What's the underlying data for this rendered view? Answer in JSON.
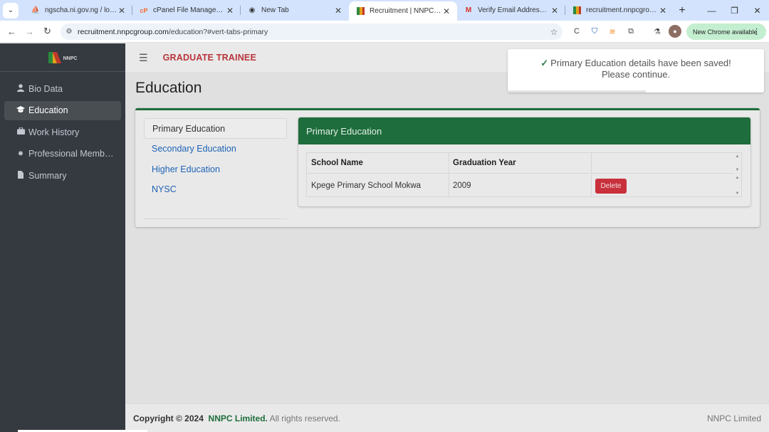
{
  "browser": {
    "tabs": [
      {
        "title": "ngscha.ni.gov.ng / localho",
        "favicon": "pma-icon",
        "active": false
      },
      {
        "title": "cPanel File Manager v3",
        "favicon": "cpanel-icon",
        "active": false
      },
      {
        "title": "New Tab",
        "favicon": "chrome-icon",
        "active": false
      },
      {
        "title": "Recruitment | NNPC Limite",
        "favicon": "nnpc-icon",
        "active": true
      },
      {
        "title": "Verify Email Address - abd",
        "favicon": "gmail-icon",
        "active": false
      },
      {
        "title": "recruitment.nnpcgroup.co",
        "favicon": "nnpc-icon",
        "active": false
      }
    ],
    "url_host": "recruitment.nnpcgroup.com",
    "url_path": "/education?#vert-tabs-primary",
    "new_chrome_label": "New Chrome available"
  },
  "sidebar": {
    "logo_text": "NNPC",
    "items": [
      {
        "label": "Bio Data",
        "icon": "user-icon",
        "active": false
      },
      {
        "label": "Education",
        "icon": "graduation-cap-icon",
        "active": true
      },
      {
        "label": "Work History",
        "icon": "briefcase-icon",
        "active": false
      },
      {
        "label": "Professional Memb…",
        "icon": "cog-icon",
        "active": false
      },
      {
        "label": "Summary",
        "icon": "file-icon",
        "active": false
      }
    ]
  },
  "topbar": {
    "title": "GRADUATE TRAINEE"
  },
  "page": {
    "title": "Education"
  },
  "education_tabs": [
    {
      "label": "Primary Education",
      "active": true
    },
    {
      "label": "Secondary Education",
      "active": false
    },
    {
      "label": "Higher Education",
      "active": false
    },
    {
      "label": "NYSC",
      "active": false
    }
  ],
  "panel": {
    "title": "Primary Education",
    "columns": [
      "School Name",
      "Graduation Year",
      ""
    ],
    "rows": [
      {
        "school": "Kpege Primary School Mokwa",
        "year": "2009",
        "action": "Delete"
      }
    ]
  },
  "footer": {
    "copyright": "Copyright © 2024",
    "company": "NNPC Limited.",
    "rights": "All rights reserved.",
    "right_text": "NNPC Limited"
  },
  "toast": {
    "message_line1": "Primary Education details have been saved!",
    "message_line2": "Please continue.",
    "progress": 0.54
  },
  "colors": {
    "brand_green": "#1e6d3c",
    "brand_red": "#b8353b",
    "sidebar_bg": "#343a40",
    "delete_red": "#c8303c"
  }
}
